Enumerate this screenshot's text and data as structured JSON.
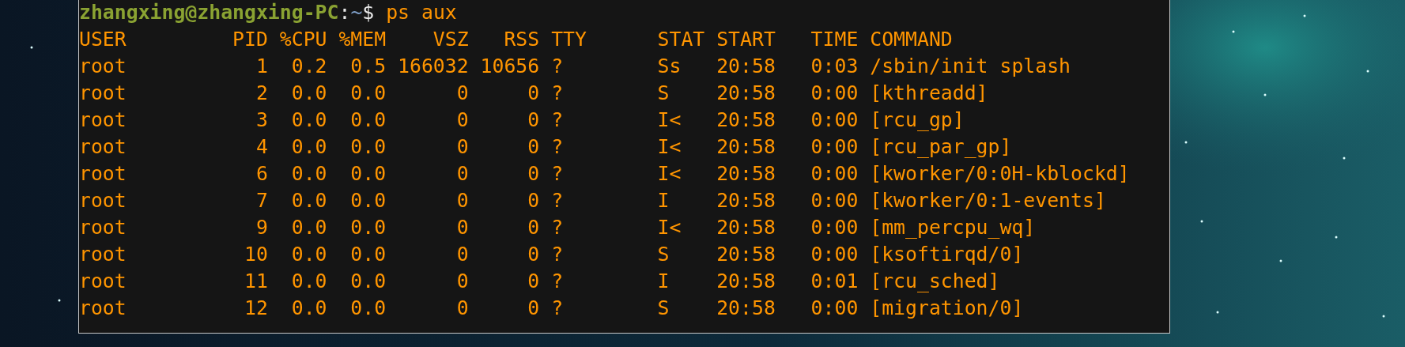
{
  "terminal": {
    "prompt": {
      "user_host": "zhangxing@zhangxing-PC",
      "separator": ":",
      "path": "~",
      "symbol": "$",
      "command": "ps aux"
    },
    "output_lines": [
      "USER         PID %CPU %MEM    VSZ   RSS TTY      STAT START   TIME COMMAND",
      "root           1  0.2  0.5 166032 10656 ?        Ss   20:58   0:03 /sbin/init splash",
      "root           2  0.0  0.0      0     0 ?        S    20:58   0:00 [kthreadd]",
      "root           3  0.0  0.0      0     0 ?        I<   20:58   0:00 [rcu_gp]",
      "root           4  0.0  0.0      0     0 ?        I<   20:58   0:00 [rcu_par_gp]",
      "root           6  0.0  0.0      0     0 ?        I<   20:58   0:00 [kworker/0:0H-kblockd]",
      "root           7  0.0  0.0      0     0 ?        I    20:58   0:00 [kworker/0:1-events]",
      "root           9  0.0  0.0      0     0 ?        I<   20:58   0:00 [mm_percpu_wq]",
      "root          10  0.0  0.0      0     0 ?        S    20:58   0:00 [ksoftirqd/0]",
      "root          11  0.0  0.0      0     0 ?        I    20:58   0:01 [rcu_sched]",
      "root          12  0.0  0.0      0     0 ?        S    20:58   0:00 [migration/0]"
    ]
  }
}
